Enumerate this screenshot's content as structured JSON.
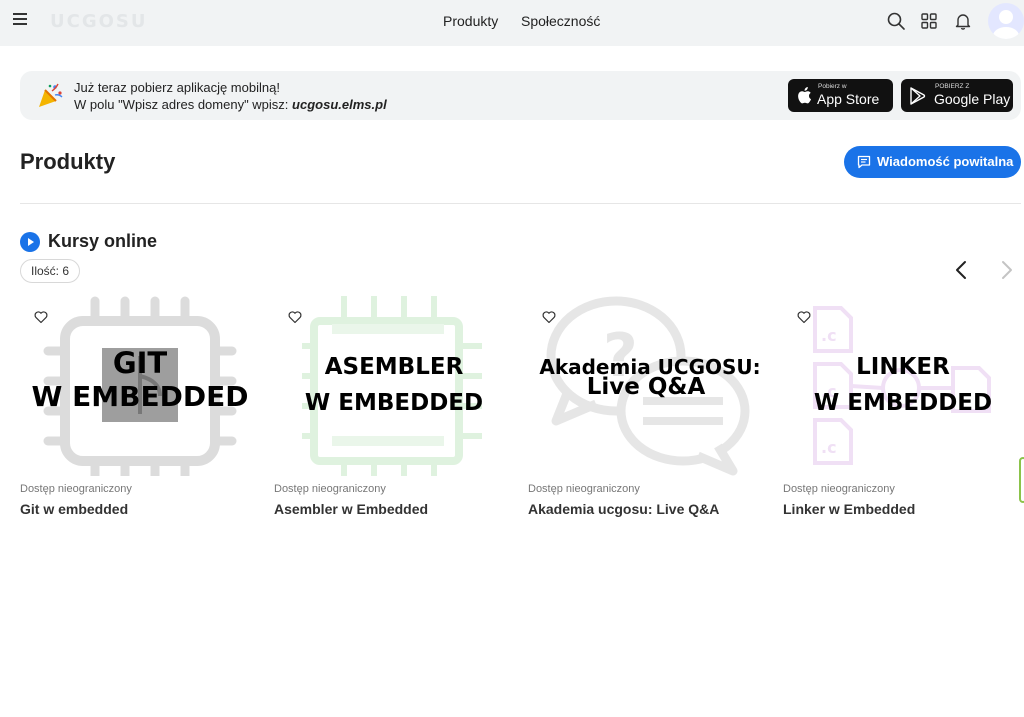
{
  "topbar": {
    "logo": "UCGOSU",
    "nav": [
      "Produkty",
      "Społeczność"
    ]
  },
  "banner": {
    "line1": "Już teraz pobierz aplikację mobilną!",
    "line2_prefix": "W polu \"Wpisz adres domeny\" wpisz:",
    "domain": "ucgosu.elms.pl",
    "apple_small": "Pobierz w",
    "apple_big": "App Store",
    "google_small": "POBIERZ Z",
    "google_big": "Google Play"
  },
  "page": {
    "title": "Produkty",
    "welcome_button": "Wiadomość powitalna"
  },
  "section": {
    "title": "Kursy online",
    "count": "Ilość: 6"
  },
  "cards": [
    {
      "thumb_l1": "GIT",
      "thumb_l2": "W EMBEDDED",
      "access": "Dostęp nieograniczony",
      "title": "Git w embedded"
    },
    {
      "thumb_l1": "ASEMBLER",
      "thumb_l2": "W EMBEDDED",
      "access": "Dostęp nieograniczony",
      "title": "Asembler w Embedded"
    },
    {
      "thumb_l1": "Akademia UCGOSU:",
      "thumb_l2": "Live Q&A",
      "access": "Dostęp nieograniczony",
      "title": "Akademia ucgosu: Live Q&A"
    },
    {
      "thumb_l1": "LINKER",
      "thumb_l2": "W EMBEDDED",
      "access": "Dostęp nieograniczony",
      "title": "Linker w Embedded"
    }
  ],
  "colors": {
    "accent": "#1a73e8",
    "topbar_bg": "#f1f3f4"
  },
  "icons": [
    "menu-icon",
    "search-icon",
    "apps-grid-icon",
    "bell-icon",
    "party-popper-icon",
    "apple-icon",
    "google-play-icon",
    "chat-icon",
    "play-icon",
    "chevron-left-icon",
    "chevron-right-icon",
    "heart-icon"
  ]
}
